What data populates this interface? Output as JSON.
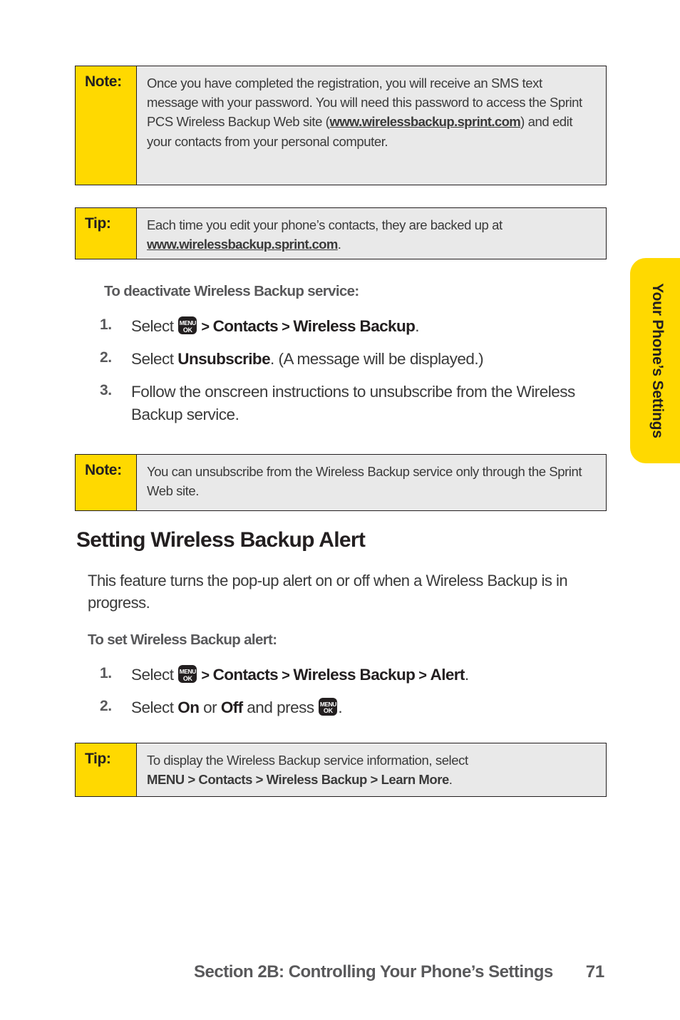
{
  "page": {
    "number": "71",
    "side_tab_label": "Your Phone’s Settings",
    "footer_section": "Section 2B: Controlling Your Phone’s Settings"
  },
  "colors": {
    "accent_yellow": "#FFD900",
    "callout_body_bg": "#E9E9E9",
    "border": "#231F20",
    "heading": "#231F20",
    "subheading_gray": "#59595B",
    "body_gray": "#3A3A3A"
  },
  "note_1": {
    "label": "Note:",
    "text_part_1": "Once you have completed the registration, you will receive an SMS text message with your password. You will need this password to access the Sprint PCS Wireless Backup Web site (",
    "link": "www.wirelessbackup.sprint.com",
    "text_part_2": ") and edit your contacts from your personal computer."
  },
  "tip_1": {
    "label": "Tip:",
    "text_part_1": "Each time you edit your phone’s contacts, they are backed up at ",
    "link": "www.wirelessbackup.sprint.com",
    "text_part_2": "."
  },
  "deactivate_section": {
    "subheading": "To deactivate Wireless Backup service:",
    "steps": [
      {
        "num": "1.",
        "lead": "Select ",
        "icon": "menu-ok-key-icon",
        "chevron_1": " > ",
        "bold_1": "Contacts",
        "chevron_2": " > ",
        "bold_2": "Wireless Backup",
        "tail": "."
      },
      {
        "num": "2.",
        "lead": "Select ",
        "bold_1": "Unsubscribe",
        "tail": ". (A message will be displayed.)"
      },
      {
        "num": "3.",
        "lead": "Follow the onscreen instructions to unsubscribe from the Wireless Backup service."
      }
    ]
  },
  "note_2": {
    "label": "Note:",
    "text": "You can unsubscribe from the Wireless Backup service only through the Sprint Web site."
  },
  "alert_section": {
    "heading": "Setting Wireless Backup Alert",
    "paragraph": "This feature turns the pop-up alert on or off when a Wireless Backup is in progress.",
    "subheading": "To set Wireless Backup alert:",
    "steps": [
      {
        "num": "1.",
        "lead": "Select ",
        "icon": "menu-ok-key-icon",
        "chevron_1": " > ",
        "bold_1": "Contacts",
        "chevron_2": " > ",
        "bold_2": "Wireless Backup",
        "chevron_3": " > ",
        "bold_3": "Alert",
        "tail": "."
      },
      {
        "num": "2.",
        "lead": "Select ",
        "bold_1": "On",
        "mid_1": " or ",
        "bold_2": "Off",
        "mid_2": " and press ",
        "icon": "menu-ok-key-icon",
        "tail": "."
      }
    ]
  },
  "tip_2": {
    "label": "Tip:",
    "text_line_1": "To display the Wireless Backup service information, select",
    "path_bold": "MENU > Contacts > Wireless Backup > Learn More",
    "tail": "."
  },
  "menu_key": {
    "top": "MENU",
    "bottom": "OK"
  }
}
